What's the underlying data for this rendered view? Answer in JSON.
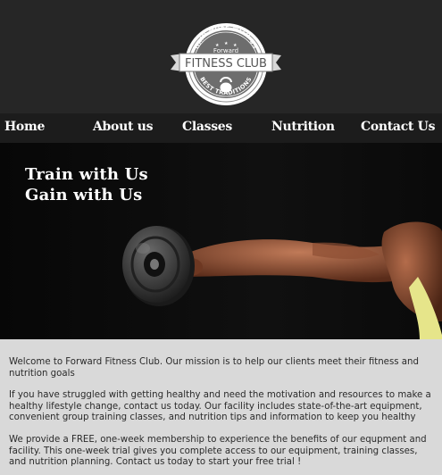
{
  "logo": {
    "top_arc": "GAIN MORE WITH US",
    "brand_small": "Forward",
    "brand": "FITNESS CLUB",
    "bottom_arc": "BEST TRADITIONS"
  },
  "nav": {
    "items": [
      {
        "label": "Home"
      },
      {
        "label": "About us"
      },
      {
        "label": "Classes"
      },
      {
        "label": "Nutrition"
      },
      {
        "label": "Contact Us"
      }
    ]
  },
  "hero": {
    "line1": "Train with Us",
    "line2": "Gain with Us"
  },
  "content": {
    "paragraphs": [
      "Welcome to Forward Fitness Club. Our mission is to help our clients meet their fitness and nutrition goals",
      "If you have struggled with getting healthy and need the motivation and resources to make a healthy lifestyle change, contact us today. Our facility includes state-of-the-art equipment, convenient group training classes, and nutrition tips and information to keep you healthy",
      "We provide a FREE, one-week membership to experience the benefits of our equpment and facility. This one-week trial gives you complete access to our equipment, training classes, and nutrition planning. Contact us today to start your free trial !"
    ]
  },
  "colors": {
    "header_bg": "#262626",
    "nav_bg": "#1c1c1c",
    "content_bg": "#d9d9d9",
    "text": "#2a2a2a"
  }
}
